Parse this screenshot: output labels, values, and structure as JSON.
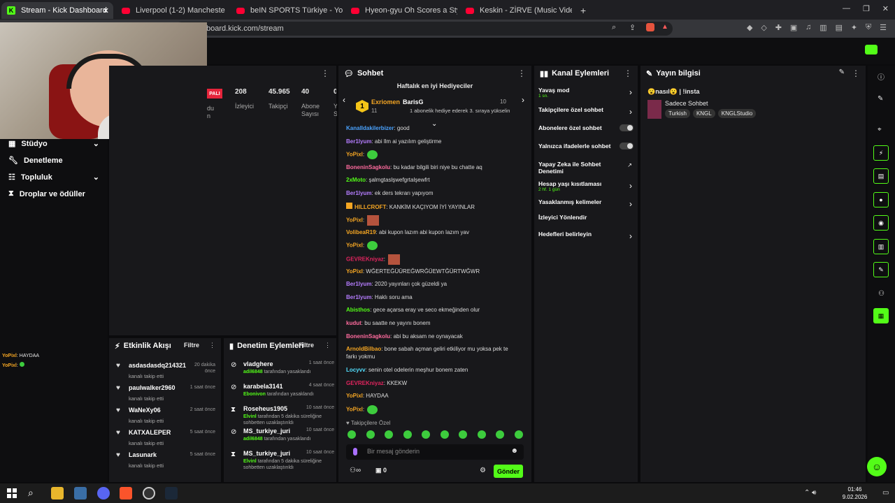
{
  "tabs": [
    {
      "label": "Stream - Kick Dashboard",
      "close": "✕"
    },
    {
      "label": "Liverpool (1-2) Manchester City | 25..."
    },
    {
      "label": "beIN SPORTS Türkiye - YouTube"
    },
    {
      "label": "Hyeon-gyu Oh Scores a Stylish Bicycl..."
    },
    {
      "label": "Keskin - ZİRVE (Music Video) - Yo..."
    },
    {
      "label": "+"
    }
  ],
  "address": "board.kick.com/stream",
  "nav": [
    {
      "label": "Stüdyo"
    },
    {
      "label": "Denetleme"
    },
    {
      "label": "Topluluk"
    },
    {
      "label": "Droplar ve ödüller"
    }
  ],
  "stats": {
    "live_badge": "PALI",
    "viewers_val": "208",
    "viewers_lbl": "İzleyici",
    "followers_val": "45.965",
    "followers_lbl": "Takipçi",
    "subs_val": "40",
    "subs_lbl": "Abone Sayısı",
    "side_a": "du",
    "side_b": "n",
    "tail_a": "Y",
    "tail_b": "S"
  },
  "mini_chat": [
    {
      "user": "YoPixl",
      "text": ": HAYDAA"
    },
    {
      "user": "YoPixl",
      "text": ": "
    }
  ],
  "activity": {
    "title": "Etkinlik Akışı",
    "filter": "Filtre",
    "items": [
      {
        "name": "asdasdasdq214321",
        "desc": "kanalı takip etti",
        "time": "20 dakika önce"
      },
      {
        "name": "paulwalker2960",
        "desc": "kanalı takip etti",
        "time": "1 saat önce"
      },
      {
        "name": "WaNeXy06",
        "desc": "kanalı takip etti",
        "time": "2 saat önce"
      },
      {
        "name": "KATXALEPER",
        "desc": "kanalı takip etti",
        "time": "5 saat önce"
      },
      {
        "name": "Lasunark",
        "desc": "kanalı takip etti",
        "time": "5 saat önce"
      }
    ]
  },
  "moderation": {
    "title": "Denetim Eylemleri",
    "filter": "Filtre",
    "items": [
      {
        "name": "vladghere",
        "by": "adil6848",
        "desc": " tarafından yasaklandı",
        "time": "1 saat önce"
      },
      {
        "name": "karabela3141",
        "by": "Ebonivon",
        "desc": " tarafından yasaklandı",
        "time": "4 saat önce"
      },
      {
        "name": "Roseheus1905",
        "by": "Elvinl",
        "desc": " tarafından 5 dakika süreliğine sohbetten uzaklaştırıldı",
        "time": "10 saat önce"
      },
      {
        "name": "MS_turkiye_juri",
        "by": "adil6848",
        "desc": " tarafından yasaklandı",
        "time": "10 saat önce"
      },
      {
        "name": "MS_turkiye_juri",
        "by": "Elvinl",
        "desc": " tarafından 5 dakika süreliğine sohbetten uzaklaştırıldı",
        "time": "10 saat önce"
      }
    ]
  },
  "chat": {
    "title": "Sohbet",
    "gifters_title": "Haftalık en iyi Hediyeciler",
    "top1": "Exriomen",
    "top1_count": "11",
    "top2": "BarisG",
    "top2_count": "10",
    "top2_desc": "1 abonelik hediye ederek 3. sıraya yükselin",
    "messages": [
      {
        "user": "Kanalldakilerbizer",
        "text": ": good",
        "color": "#4aa3ff"
      },
      {
        "user": "Ber1lyum",
        "text": ": abi llm ai yazılım geliştirme",
        "color": "#b57dff"
      },
      {
        "user": "YoPixl",
        "text": ":",
        "color": "#f5a623"
      },
      {
        "user": "BoneninSagkolu",
        "text": ": bu kadar bilgili biri niye bu chatte aq",
        "color": "#ff6b9e"
      },
      {
        "user": "2xMoto",
        "text": ": şalmgtaslşwefgrtalşewfrt",
        "color": "#53fc18"
      },
      {
        "user": "Ber1lyum",
        "text": ": ek ders tekrarı yapıyom",
        "color": "#b57dff"
      },
      {
        "user": "HILLCROFT",
        "text": ": KANKİM KAÇIYOM İYİ YAYINLAR",
        "color": "#f5a623"
      },
      {
        "user": "YoPixl",
        "text": ":",
        "color": "#f5a623"
      },
      {
        "user": "VolibeaR19",
        "text": ": abi kupon lazım abi kupon lazım yav",
        "color": "#f5a623"
      },
      {
        "user": "YoPixl",
        "text": ":",
        "color": "#f5a623"
      },
      {
        "user": "GEVREKniyaz",
        "text": ":",
        "color": "#e0245e"
      },
      {
        "user": "YoPixl",
        "text": ": WĞERTEĞÜÜREĞWRĞÜEWTĞÜRTWĞWR",
        "color": "#f5a623"
      },
      {
        "user": "Ber1lyum",
        "text": ": 2020 yayınları çok güzeldi ya",
        "color": "#b57dff"
      },
      {
        "user": "Ber1lyum",
        "text": ": Haklı soru ama",
        "color": "#b57dff"
      },
      {
        "user": "Abisthos",
        "text": ": gece açarsa eray ve seco ekmeğinden olur",
        "color": "#53fc18"
      },
      {
        "user": "kudut",
        "text": ": bu saatte ne yayını bonem",
        "color": "#ff6b9e"
      },
      {
        "user": "BoneninSagkolu",
        "text": ": abi bu aksam ne oynayacak",
        "color": "#ff6b9e"
      },
      {
        "user": "ArnoldBilbao",
        "text": ": bone sabah açman geliri etkiliyor mu yoksa pek te farkı yokmu",
        "color": "#f5a623"
      },
      {
        "user": "Locyvv",
        "text": ": senin otel odelerin meşhur bonem zaten",
        "color": "#53e0ff"
      },
      {
        "user": "GEVREKniyaz",
        "text": ": KKEKW",
        "color": "#e0245e"
      },
      {
        "user": "YoPixl",
        "text": ": HAYDAA",
        "color": "#f5a623"
      },
      {
        "user": "YoPixl",
        "text": ":",
        "color": "#f5a623"
      }
    ],
    "follower_only": "Takipçilere Özel",
    "placeholder": "Bir mesaj gönderin",
    "count": "0",
    "send": "Gönder"
  },
  "channel": {
    "title": "Kanal Eylemleri",
    "items": [
      {
        "label": "Yavaş mod",
        "sub": "1 sn.",
        "control": "chevron"
      },
      {
        "label": "Takipçilere özel sohbet",
        "sub": "",
        "control": "chevron"
      },
      {
        "label": "Abonelere özel sohbet",
        "sub": "",
        "control": "toggle"
      },
      {
        "label": "Yalnızca ifadelerle sohbet",
        "sub": "",
        "control": "toggle"
      },
      {
        "label": "Yapay Zeka ile Sohbet Denetimi",
        "sub": "",
        "control": "external"
      },
      {
        "label": "Hesap yaşı kısıtlaması",
        "sub": "2 hf. 1 gün",
        "control": "chevron"
      },
      {
        "label": "Yasaklanmış kelimeler",
        "sub": "",
        "control": "chevron"
      },
      {
        "label": "İzleyici Yönlendir",
        "sub": "",
        "control": "none"
      },
      {
        "label": "Hedefleri belirleyin",
        "sub": "",
        "control": "chevron"
      }
    ]
  },
  "stream_info": {
    "title": "Yayın bilgisi",
    "stream_title": "😮nasıl😮 | !insta",
    "category": "Sadece Sohbet",
    "tags": [
      "Turkish",
      "KNGL",
      "KNGLStudio"
    ]
  },
  "clock": {
    "time": "01:46",
    "date": "9.02.2026"
  }
}
